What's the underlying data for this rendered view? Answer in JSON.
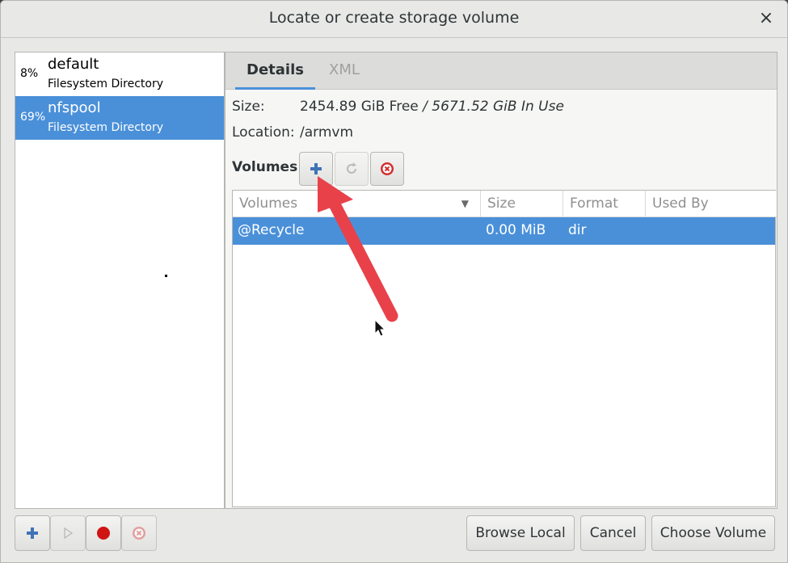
{
  "window": {
    "title": "Locate or create storage volume",
    "close_glyph": "×"
  },
  "pools": [
    {
      "percent": "8%",
      "name": "default",
      "type": "Filesystem Directory",
      "selected": false
    },
    {
      "percent": "69%",
      "name": "nfspool",
      "type": "Filesystem Directory",
      "selected": true
    }
  ],
  "tabs": [
    {
      "label": "Details",
      "active": true
    },
    {
      "label": "XML",
      "active": false
    }
  ],
  "details": {
    "size_label": "Size:",
    "size_free": "2454.89 GiB Free",
    "size_separator": " / ",
    "size_in_use": "5671.52 GiB In Use",
    "location_label": "Location:",
    "location_value": "/armvm",
    "volumes_label": "Volumes"
  },
  "volume_toolbar": {
    "add_icon": "add-icon",
    "refresh_icon": "refresh-icon",
    "delete_icon": "delete-icon"
  },
  "table": {
    "columns": [
      "Volumes",
      "Size",
      "Format",
      "Used By"
    ],
    "sort_glyph": "▼",
    "rows": [
      {
        "name": "@Recycle",
        "size": "0.00 MiB",
        "format": "dir",
        "used_by": ""
      }
    ]
  },
  "bottom": {
    "browse_local": "Browse Local",
    "cancel": "Cancel",
    "choose_volume": "Choose Volume"
  },
  "colors": {
    "selection": "#4a90d9",
    "annotation_arrow": "#e8414a"
  }
}
